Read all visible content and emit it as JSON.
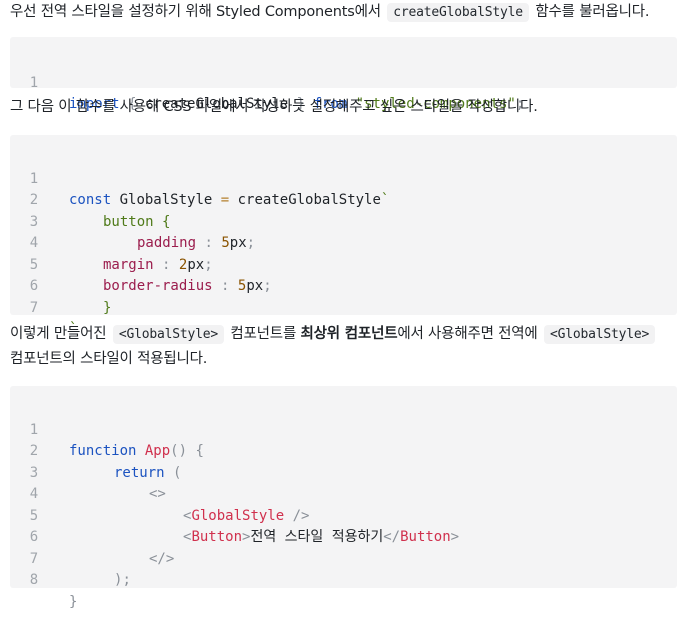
{
  "p1": {
    "before": "우선 전역 스타일을 설정하기 위해 Styled Components에서",
    "code": "createGlobalStyle",
    "after": "함수를 불러옵니다."
  },
  "code1": {
    "lines": [
      {
        "num": "1",
        "keyword1": "import",
        "brace_open": "{",
        "name": "createGlobalStyle",
        "brace_close": "}",
        "keyword2": "from",
        "string": "\"styled-components\"",
        "semi": ";"
      }
    ]
  },
  "p2": {
    "text": "그 다음 이 함수를 사용해 CSS 파일에서 작성하듯 설정해주고 싶은 스타일을 작성합니다."
  },
  "code2": {
    "lines": [
      {
        "num": "1",
        "keyword": "const",
        "name": "GlobalStyle",
        "op": "=",
        "fn": "createGlobalStyle",
        "tick": "`"
      },
      {
        "num": "2",
        "selector": "button",
        "brace": "{"
      },
      {
        "num": "3",
        "prop": "padding",
        "colon": ":",
        "value": "5",
        "unit": "px",
        "semi": ";"
      },
      {
        "num": "4",
        "prop": "margin",
        "colon": ":",
        "value": "2",
        "unit": "px",
        "semi": ";"
      },
      {
        "num": "5",
        "prop": "border-radius",
        "colon": ":",
        "value": "5",
        "unit": "px",
        "semi": ";"
      },
      {
        "num": "6",
        "brace": "}"
      },
      {
        "num": "7",
        "tick": "`"
      }
    ]
  },
  "p3": {
    "before": "이렇게 만들어진",
    "code1": "<GlobalStyle>",
    "mid1": "컴포넌트를",
    "bold": "최상위 컴포넌트",
    "mid2": "에서 사용해주면 전역에",
    "code2": "<GlobalStyle>",
    "line2": "컴포넌트의 스타일이 적용됩니다."
  },
  "code3": {
    "lines": [
      {
        "num": "1",
        "keyword": "function",
        "fn": "App",
        "paren": "()",
        "brace": "{"
      },
      {
        "num": "2",
        "keyword": "return",
        "paren": "("
      },
      {
        "num": "3",
        "tag": "<>"
      },
      {
        "num": "4",
        "lt": "<",
        "comp": "GlobalStyle",
        "end": "/>"
      },
      {
        "num": "5",
        "lt": "<",
        "comp": "Button",
        "gt": ">",
        "text": "전역 스타일 적용하기",
        "close_lt": "</",
        "close_comp": "Button",
        "close_gt": ">"
      },
      {
        "num": "6",
        "tag": "</>"
      },
      {
        "num": "7",
        "paren": ")",
        "semi": ";"
      },
      {
        "num": "8",
        "brace": "}"
      }
    ]
  },
  "colors": {
    "keyword": "#1c53c0",
    "string": "#4f7a19",
    "property": "#9b1d4d",
    "component": "#d0304d",
    "code_bg": "#f4f4f5"
  }
}
